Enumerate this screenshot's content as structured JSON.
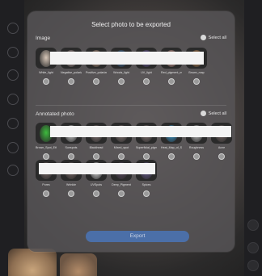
{
  "modal": {
    "title": "Select photo to be exported",
    "export_label": "Export"
  },
  "image_section": {
    "label": "Image",
    "select_all": "Select all",
    "items": [
      {
        "label": "White_light",
        "color": "#d8c7b8"
      },
      {
        "label": "Negative_polarized_light",
        "color": "#b9a3a0"
      },
      {
        "label": "Positive_polarized_light",
        "color": "#c3a08a"
      },
      {
        "label": "Woods_light",
        "color": "#3c6fa0"
      },
      {
        "label": "UV_light",
        "color": "#6a58a0"
      },
      {
        "label": "Red_pigment_map",
        "color": "#e9b0a6"
      },
      {
        "label": "Brown_map",
        "color": "#c78a52"
      }
    ]
  },
  "annotated_section": {
    "label": "Annotated photo",
    "select_all": "Select all",
    "row1": [
      {
        "label": "Brown_Spot_Ethnic",
        "color": "#3dbb3d"
      },
      {
        "label": "Sunspots",
        "color": "#d9d9d9"
      },
      {
        "label": "Blackhead",
        "color": "#8a7a78"
      },
      {
        "label": "Mixed_spot",
        "color": "#8a7a78"
      },
      {
        "label": "Superficial_pigment",
        "color": "#8a7a78"
      },
      {
        "label": "Heat_Map_of_Sensitivity",
        "color": "#3aa0d8"
      },
      {
        "label": "Roughness",
        "color": "#c8c8c8"
      },
      {
        "label": "Acne",
        "color": "#7a6a68"
      }
    ],
    "row2": [
      {
        "label": "Pores",
        "color": "#7a6a68"
      },
      {
        "label": "Wrinkle",
        "color": "#7a6a68"
      },
      {
        "label": "UVSpots",
        "color": "#e6e6e6"
      },
      {
        "label": "Deep_Pigment",
        "color": "#5a4a60"
      },
      {
        "label": "Spices",
        "color": "#6a5e90"
      }
    ]
  }
}
